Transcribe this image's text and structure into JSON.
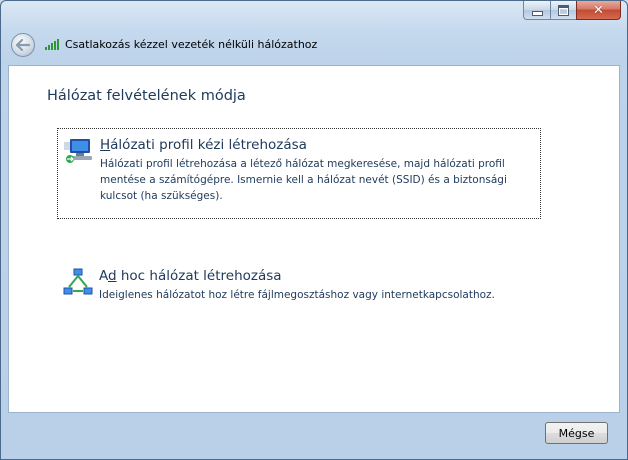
{
  "window": {
    "nav_title": "Csatlakozás kézzel vezeték nélküli hálózathoz",
    "caption_buttons": {
      "minimize_icon": "minimize-icon",
      "maximize_icon": "maximize-icon",
      "close_glyph": "✕"
    }
  },
  "main": {
    "heading": "Hálózat felvételének módja",
    "options": [
      {
        "title": "Hálózati profil kézi létrehozása",
        "accelerator": "H",
        "description": "Hálózati profil létrehozása a létező hálózat megkeresése, majd hálózati profil mentése a számítógépre. Ismernie kell a hálózat nevét (SSID) és a biztonsági kulcsot (ha szükséges).",
        "icon": "manual-network-profile-icon"
      },
      {
        "title": "Ad hoc hálózat létrehozása",
        "accelerator": "d",
        "description": "Ideiglenes hálózatot hoz létre fájlmegosztáshoz vagy internetkapcsolathoz.",
        "icon": "adhoc-network-icon"
      }
    ]
  },
  "footer": {
    "cancel_label": "Mégse"
  },
  "colors": {
    "link_text": "#1e395b",
    "frame": "#bdd3ea"
  }
}
